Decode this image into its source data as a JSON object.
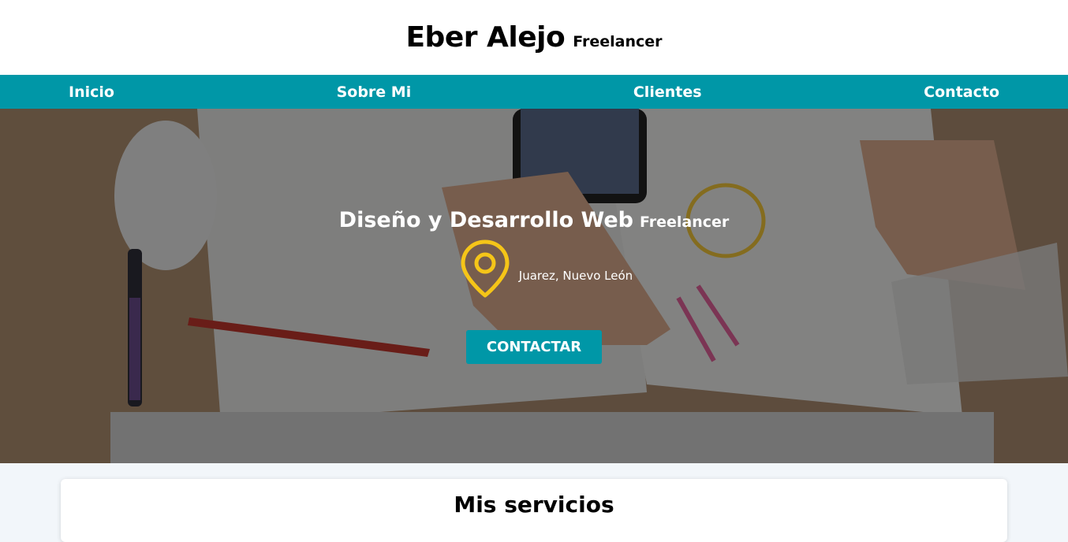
{
  "header": {
    "name": "Eber Alejo",
    "tagline": "Freelancer"
  },
  "nav": {
    "items": [
      "Inicio",
      "Sobre Mi",
      "Clientes",
      "Contacto"
    ]
  },
  "hero": {
    "title": "Diseño y Desarrollo Web",
    "tagline": "Freelancer",
    "location": "Juarez, Nuevo León",
    "cta": "CONTACTAR"
  },
  "services": {
    "title": "Mis servicios"
  },
  "colors": {
    "accent": "#0097a7",
    "pin": "#f5c518"
  }
}
